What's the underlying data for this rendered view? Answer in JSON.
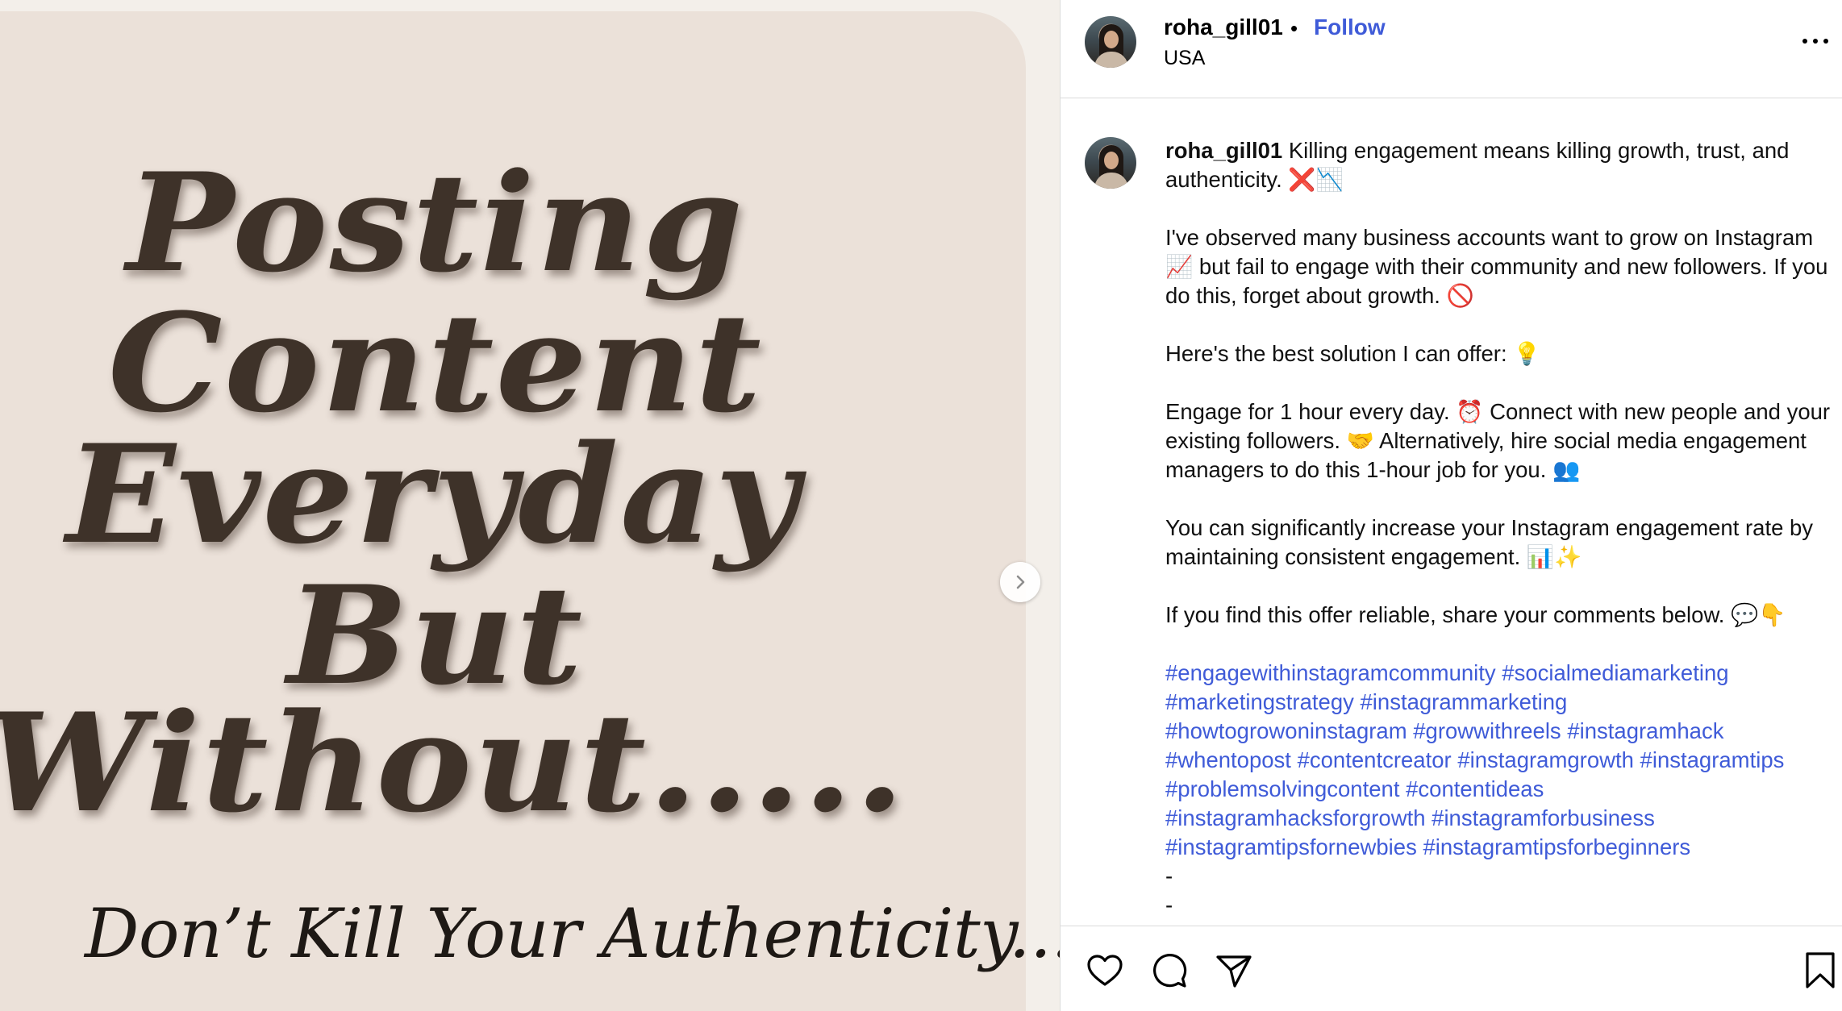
{
  "post_image": {
    "headline_lines": [
      "Posting",
      "Content",
      "Everyday",
      "But",
      "Without....."
    ],
    "subline": "Don’t Kill Your Authenticity........"
  },
  "header": {
    "username": "roha_gill01",
    "separator": "•",
    "follow_label": "Follow",
    "location": "USA"
  },
  "caption": {
    "username": "roha_gill01",
    "paragraphs": [
      "Killing engagement means killing growth, trust, and authenticity. ❌📉",
      "I've observed many business accounts want to grow on Instagram 📈 but fail to engage with their community and new followers. If you do this, forget about growth. 🚫",
      "Here's the best solution I can offer: 💡",
      "Engage for 1 hour every day. ⏰ Connect with new people and your existing followers. 🤝 Alternatively, hire social media engagement managers to do this 1-hour job for you. 👥",
      "You can significantly increase your Instagram engagement rate by maintaining consistent engagement. 📊✨",
      "If you find this offer reliable, share your comments below. 💬👇"
    ],
    "hashtags": [
      "#engagewithinstagramcommunity",
      "#socialmediamarketing",
      "#marketingstrategy",
      "#instagrammarketing",
      "#howtogrowoninstagram",
      "#growwithreels",
      "#instagramhack",
      "#whentopost",
      "#contentcreator",
      "#instagramgrowth",
      "#instagramtips",
      "#problemsolvingcontent",
      "#contentideas",
      "#instagramhacksforgrowth",
      "#instagramforbusiness",
      "#instagramtipsfornewbies",
      "#instagramtipsforbeginners"
    ],
    "trailing": [
      "-",
      "-"
    ]
  },
  "icons": {
    "next": "chevron-right-icon",
    "more": "more-horizontal-icon",
    "like": "heart-icon",
    "comment": "comment-icon",
    "share": "paper-plane-icon",
    "save": "bookmark-icon"
  },
  "colors": {
    "link": "#3f5bd8",
    "slide_background": "#ebe1d9",
    "headline": "#3e3229"
  }
}
